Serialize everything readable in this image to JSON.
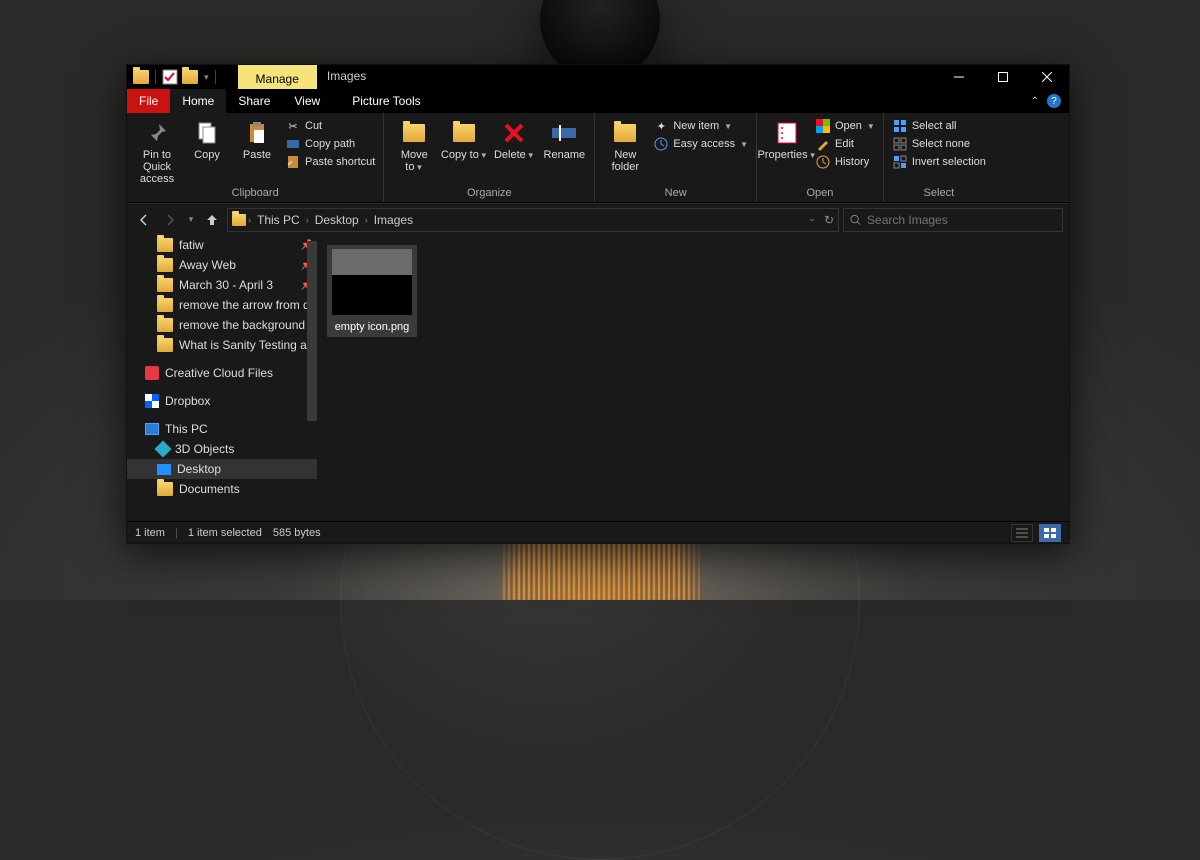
{
  "titlebar": {
    "context_tab": "Manage",
    "title": "Images"
  },
  "tabs": {
    "file": "File",
    "home": "Home",
    "share": "Share",
    "view": "View",
    "picture_tools": "Picture Tools"
  },
  "ribbon": {
    "pin": "Pin to Quick access",
    "copy": "Copy",
    "paste": "Paste",
    "cut": "Cut",
    "copy_path": "Copy path",
    "paste_shortcut": "Paste shortcut",
    "clipboard_group": "Clipboard",
    "move_to": "Move to",
    "copy_to": "Copy to",
    "delete": "Delete",
    "rename": "Rename",
    "organize_group": "Organize",
    "new_folder": "New folder",
    "new_item": "New item",
    "easy_access": "Easy access",
    "new_group": "New",
    "properties": "Properties",
    "open": "Open",
    "edit": "Edit",
    "history": "History",
    "open_group": "Open",
    "select_all": "Select all",
    "select_none": "Select none",
    "invert_selection": "Invert selection",
    "select_group": "Select"
  },
  "breadcrumb": {
    "seg1": "This PC",
    "seg2": "Desktop",
    "seg3": "Images"
  },
  "search": {
    "placeholder": "Search Images"
  },
  "sidebar": {
    "items": [
      {
        "label": "fatiw",
        "icon": "folder",
        "pinned": true,
        "sub": true
      },
      {
        "label": "Away Web",
        "icon": "folder",
        "pinned": true,
        "sub": true
      },
      {
        "label": "March 30 - April 3",
        "icon": "folder",
        "pinned": true,
        "sub": true
      },
      {
        "label": "remove the arrow from desktop",
        "icon": "folder",
        "pinned": false,
        "sub": true
      },
      {
        "label": "remove the background from",
        "icon": "folder",
        "pinned": false,
        "sub": true
      },
      {
        "label": "What is Sanity Testing and",
        "icon": "folder",
        "pinned": false,
        "sub": true
      },
      {
        "label": "Creative Cloud Files",
        "icon": "cc",
        "pinned": false,
        "sub": false
      },
      {
        "label": "Dropbox",
        "icon": "db",
        "pinned": false,
        "sub": false
      },
      {
        "label": "This PC",
        "icon": "pc",
        "pinned": false,
        "sub": false
      },
      {
        "label": "3D Objects",
        "icon": "obj",
        "pinned": false,
        "sub": true
      },
      {
        "label": "Desktop",
        "icon": "dsk",
        "pinned": false,
        "sub": true,
        "sel": true
      },
      {
        "label": "Documents",
        "icon": "folder",
        "pinned": false,
        "sub": true
      }
    ]
  },
  "content": {
    "file_name": "empty icon.png"
  },
  "status": {
    "count": "1 item",
    "selected": "1 item selected",
    "size": "585 bytes"
  }
}
